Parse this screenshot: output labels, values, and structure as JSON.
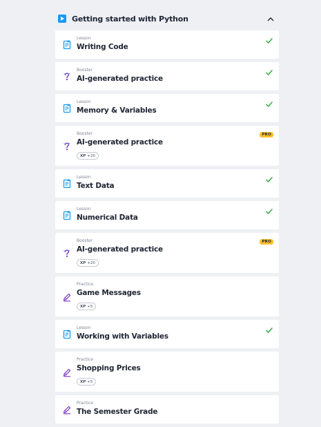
{
  "section": {
    "title": "Getting started with Python"
  },
  "items": [
    {
      "kind": "Lesson",
      "name": "Writing Code",
      "icon": "lesson-icon",
      "done": true
    },
    {
      "kind": "Booster",
      "name": "AI-generated practice",
      "icon": "booster-icon",
      "done": true
    },
    {
      "kind": "Lesson",
      "name": "Memory & Variables",
      "icon": "lesson-icon",
      "done": true
    },
    {
      "kind": "Booster",
      "name": "AI-generated practice",
      "icon": "booster-icon",
      "pro": "PRO",
      "xp_label": "XP",
      "xp_value": "+20"
    },
    {
      "kind": "Lesson",
      "name": "Text Data",
      "icon": "lesson-icon",
      "done": true
    },
    {
      "kind": "Lesson",
      "name": "Numerical Data",
      "icon": "lesson-icon",
      "done": true
    },
    {
      "kind": "Booster",
      "name": "AI-generated practice",
      "icon": "booster-icon",
      "pro": "PRO",
      "xp_label": "XP",
      "xp_value": "+20"
    },
    {
      "kind": "Practice",
      "name": "Game Messages",
      "icon": "practice-icon",
      "xp_label": "XP",
      "xp_value": "+5"
    },
    {
      "kind": "Lesson",
      "name": "Working with Variables",
      "icon": "lesson-icon",
      "done": true
    },
    {
      "kind": "Practice",
      "name": "Shopping Prices",
      "icon": "practice-icon",
      "xp_label": "XP",
      "xp_value": "+5"
    },
    {
      "kind": "Practice",
      "name": "The Semester Grade",
      "icon": "practice-icon"
    }
  ],
  "colors": {
    "accent": "#1a9bf0",
    "done": "#3fae4a",
    "booster": "#7b3fc4",
    "pro": "#fbbe2e"
  }
}
